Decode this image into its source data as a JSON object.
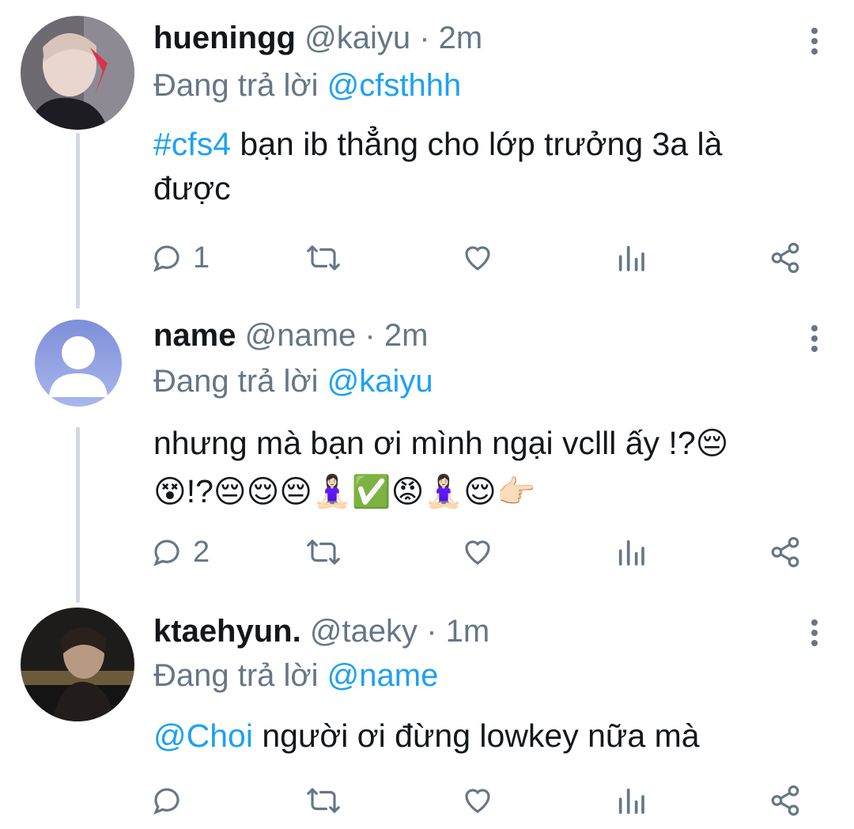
{
  "colors": {
    "accent": "#1da1f2",
    "muted": "#657786",
    "text": "#14171a",
    "thread_line": "#cfd9de"
  },
  "tweets": [
    {
      "display_name": "hueningg",
      "handle": "@kaiyu",
      "separator": "·",
      "time": "2m",
      "replying_prefix": "Đang trả lời",
      "replying_to": "@cfsthhh",
      "hashtag": "#cfs4",
      "text_line1": " bạn ib thẳng cho lớp trưởng 3a là",
      "text_line2": "được",
      "reply_count": "1"
    },
    {
      "display_name": "name",
      "handle": "@name",
      "separator": "·",
      "time": "2m",
      "replying_prefix": "Đang trả lời",
      "replying_to": "@kaiyu",
      "text_line1": "nhưng mà bạn ơi mình ngại vclll ấy !?",
      "emoji_line1_end": "😔",
      "text_line2_a": "😵",
      "text_line2_b": "!?",
      "emoji_line2": "😔😌😔🧘🏻‍♀️✅😡🧘🏻‍♀️😌👉🏻",
      "reply_count": "2"
    },
    {
      "display_name": "ktaehyun.",
      "handle": "@taeky",
      "separator": "·",
      "time": "1m",
      "replying_prefix": "Đang trả lời",
      "replying_to": "@name",
      "mention": "@Choi",
      "text": " người ơi đừng lowkey nữa mà",
      "reply_count": ""
    }
  ]
}
